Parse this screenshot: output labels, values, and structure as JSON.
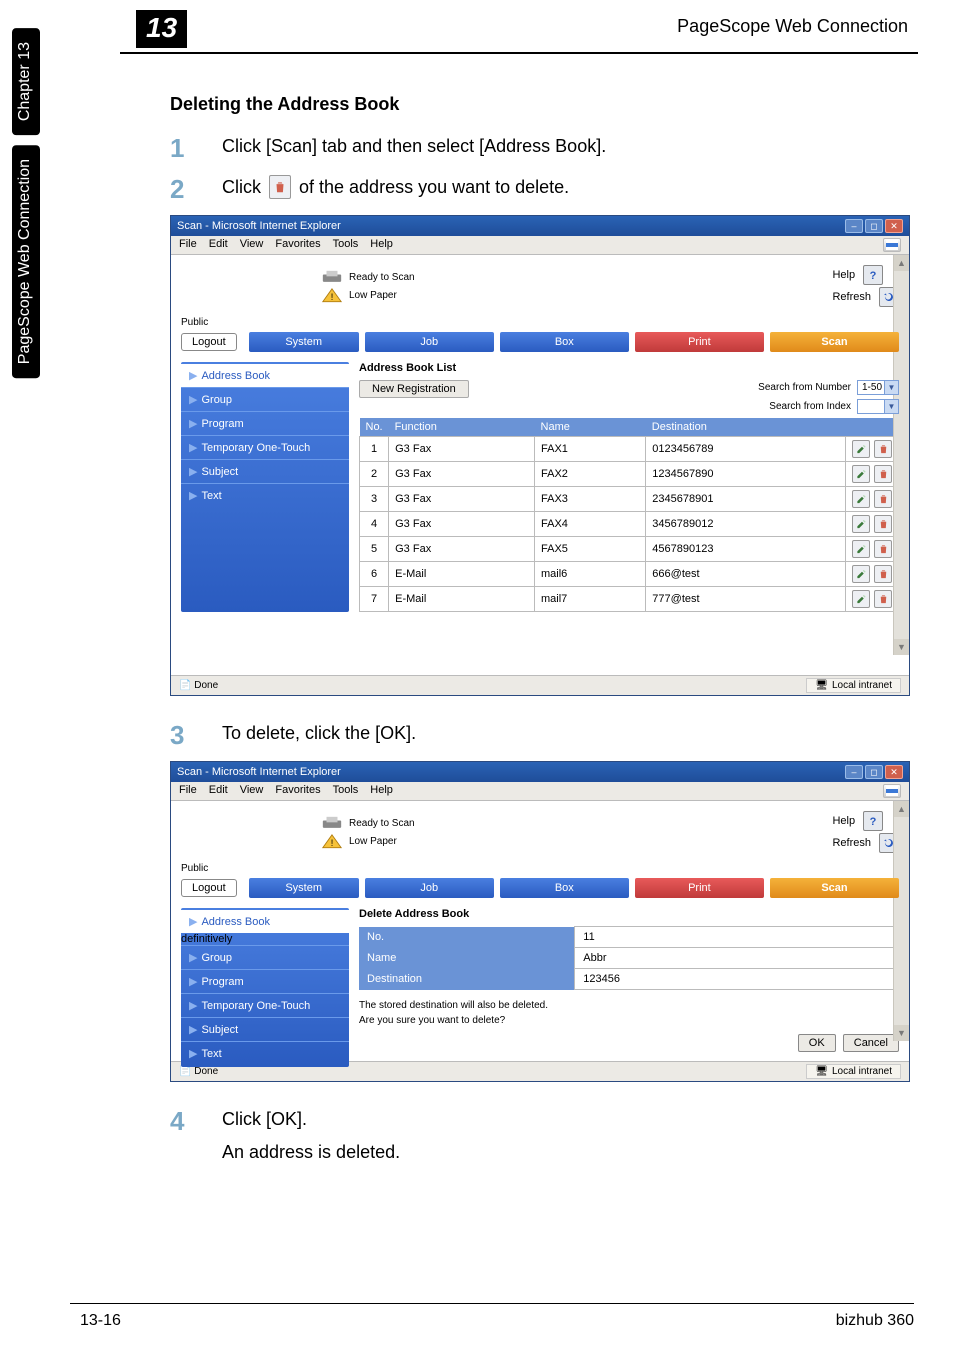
{
  "chapter": {
    "number": "13",
    "side_label_1": "Chapter 13",
    "side_label_2": "PageScope Web Connection",
    "header_title": "PageScope Web Connection"
  },
  "section": {
    "title": "Deleting the Address Book"
  },
  "steps": {
    "s1": {
      "num": "1",
      "text": "Click [Scan] tab and then select [Address Book]."
    },
    "s2": {
      "num": "2",
      "pre": "Click",
      "post": "of the address you want to delete."
    },
    "s3": {
      "num": "3",
      "text": "To delete, click the [OK]."
    },
    "s4": {
      "num": "4",
      "text": "Click [OK].",
      "sub": "An address is deleted."
    }
  },
  "ie": {
    "title": "Scan - Microsoft Internet Explorer",
    "menus": [
      "File",
      "Edit",
      "View",
      "Favorites",
      "Tools",
      "Help"
    ],
    "status_done": "Done",
    "zone": "Local intranet"
  },
  "shot1": {
    "status_ready": "Ready to Scan",
    "status_low": "Low Paper",
    "help": "Help",
    "refresh": "Refresh",
    "public": "Public",
    "logout": "Logout",
    "tabs": {
      "system": "System",
      "job": "Job",
      "box": "Box",
      "print": "Print",
      "scan": "Scan"
    },
    "sidemenu": [
      "Address Book",
      "Group",
      "Program",
      "Temporary One-Touch",
      "Subject",
      "Text"
    ],
    "heading": "Address Book List",
    "new_reg": "New Registration",
    "search_num": "Search from Number",
    "search_num_val": "1-50",
    "search_idx": "Search from Index",
    "cols": {
      "no": "No.",
      "func": "Function",
      "name": "Name",
      "dest": "Destination"
    },
    "rows": [
      {
        "no": "1",
        "func": "G3 Fax",
        "name": "FAX1",
        "dest": "0123456789"
      },
      {
        "no": "2",
        "func": "G3 Fax",
        "name": "FAX2",
        "dest": "1234567890"
      },
      {
        "no": "3",
        "func": "G3 Fax",
        "name": "FAX3",
        "dest": "2345678901"
      },
      {
        "no": "4",
        "func": "G3 Fax",
        "name": "FAX4",
        "dest": "3456789012"
      },
      {
        "no": "5",
        "func": "G3 Fax",
        "name": "FAX5",
        "dest": "4567890123"
      },
      {
        "no": "6",
        "func": "E-Mail",
        "name": "mail6",
        "dest": "666@test"
      },
      {
        "no": "7",
        "func": "E-Mail",
        "name": "mail7",
        "dest": "777@test"
      }
    ]
  },
  "shot2": {
    "heading": "Delete Address Book",
    "kv": {
      "no_label": "No.",
      "no_val": "11",
      "name_label": "Name",
      "name_val": "Abbr",
      "dest_label": "Destination",
      "dest_val": "123456"
    },
    "msg1": "The stored destination will also be deleted.",
    "msg2": "Are you sure you want to delete?",
    "ok": "OK",
    "cancel": "Cancel"
  },
  "footer": {
    "left": "13-16",
    "right": "bizhub 360"
  }
}
